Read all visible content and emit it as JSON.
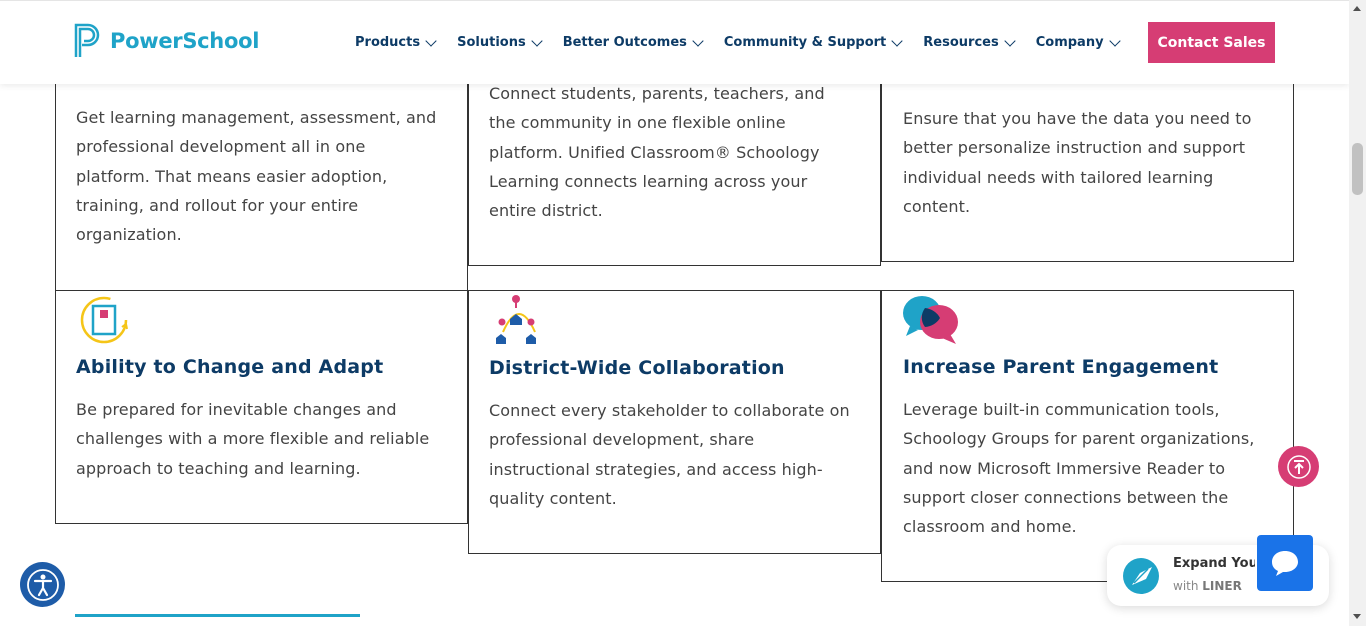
{
  "header": {
    "logo_text": "PowerSchool",
    "nav": [
      {
        "label": "Products"
      },
      {
        "label": "Solutions"
      },
      {
        "label": "Better Outcomes"
      },
      {
        "label": "Community & Support"
      },
      {
        "label": "Resources"
      },
      {
        "label": "Company"
      }
    ],
    "cta_label": "Contact Sales"
  },
  "cards_top": [
    {
      "text_lines": [
        "Get learning management, assessment, and",
        "professional development all in one",
        "platform. That means easier adoption,",
        "training, and rollout for your entire",
        "organization."
      ]
    },
    {
      "text_lines": [
        "Connect students, parents, teachers, and",
        "the community in one flexible online",
        "platform. Unified Classroom® Schoology",
        "Learning connects learning across your",
        "entire district."
      ]
    },
    {
      "text_lines": [
        "Ensure that you have the data you need to",
        "better personalize instruction and support",
        "individual needs with tailored learning",
        "content."
      ]
    }
  ],
  "cards_bottom": [
    {
      "title": "Ability to Change and Adapt",
      "icon": "adapt-document-icon",
      "text_lines": [
        "Be prepared for inevitable changes and",
        "challenges with a more flexible and reliable",
        "approach to teaching and learning."
      ]
    },
    {
      "title": "District-Wide Collaboration",
      "icon": "collaboration-network-icon",
      "text_lines": [
        "Connect every stakeholder to collaborate on",
        "professional development, share",
        "instructional strategies, and access high-",
        "quality content."
      ]
    },
    {
      "title": "Increase Parent Engagement",
      "icon": "speech-bubbles-icon",
      "text_lines": [
        "Leverage built-in communication tools,",
        "Schoology Groups for parent organizations,",
        "and now Microsoft Immersive Reader to",
        "support closer connections between the",
        "classroom and home."
      ]
    }
  ],
  "widgets": {
    "liner_title": "Expand Your",
    "liner_sub_prefix": "with ",
    "liner_sub_brand": "LINER"
  },
  "colors": {
    "brand": "#1fa3c8",
    "navy": "#0d3b66",
    "accent": "#d63d74"
  }
}
